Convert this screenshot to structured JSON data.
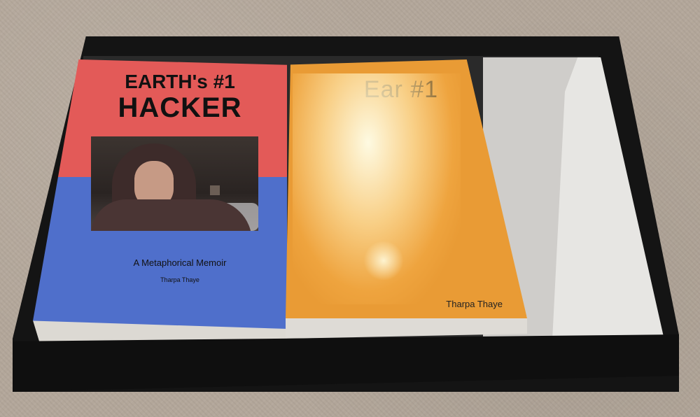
{
  "book_left": {
    "title_line1": "EARTH's #1",
    "title_line2": "HACKER",
    "subtitle": "A Metaphorical Memoir",
    "author": "Tharpa Thaye"
  },
  "book_right": {
    "title_visible": "Ear      #1",
    "author": "Tharpa Thaye"
  },
  "colors": {
    "carpet": "#b3a79a",
    "box": "#141414",
    "book_red": "#e35a58",
    "book_blue": "#4f6fcb",
    "book_orange": "#e99b35"
  }
}
